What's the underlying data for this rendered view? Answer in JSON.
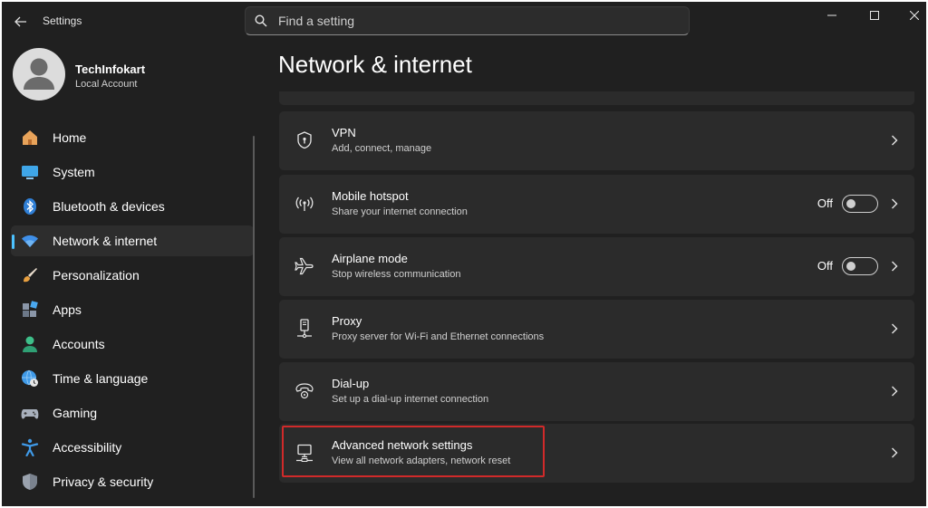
{
  "app": {
    "title": "Settings"
  },
  "search": {
    "placeholder": "Find a setting"
  },
  "profile": {
    "name": "TechInfokart",
    "account_type": "Local Account"
  },
  "sidebar": {
    "items": [
      {
        "label": "Home",
        "icon": "home-icon"
      },
      {
        "label": "System",
        "icon": "system-icon"
      },
      {
        "label": "Bluetooth & devices",
        "icon": "bluetooth-icon"
      },
      {
        "label": "Network & internet",
        "icon": "wifi-icon",
        "active": true
      },
      {
        "label": "Personalization",
        "icon": "brush-icon"
      },
      {
        "label": "Apps",
        "icon": "apps-icon"
      },
      {
        "label": "Accounts",
        "icon": "accounts-icon"
      },
      {
        "label": "Time & language",
        "icon": "globe-clock-icon"
      },
      {
        "label": "Gaming",
        "icon": "gamepad-icon"
      },
      {
        "label": "Accessibility",
        "icon": "accessibility-icon"
      },
      {
        "label": "Privacy & security",
        "icon": "shield-icon"
      }
    ]
  },
  "main": {
    "title": "Network & internet",
    "cards": [
      {
        "title": "VPN",
        "subtitle": "Add, connect, manage",
        "icon": "vpn-shield-icon"
      },
      {
        "title": "Mobile hotspot",
        "subtitle": "Share your internet connection",
        "icon": "hotspot-icon",
        "toggle": {
          "state_label": "Off",
          "on": false
        }
      },
      {
        "title": "Airplane mode",
        "subtitle": "Stop wireless communication",
        "icon": "airplane-icon",
        "toggle": {
          "state_label": "Off",
          "on": false
        }
      },
      {
        "title": "Proxy",
        "subtitle": "Proxy server for Wi-Fi and Ethernet connections",
        "icon": "proxy-icon"
      },
      {
        "title": "Dial-up",
        "subtitle": "Set up a dial-up internet connection",
        "icon": "dialup-icon"
      },
      {
        "title": "Advanced network settings",
        "subtitle": "View all network adapters, network reset",
        "icon": "network-adapter-icon",
        "highlighted": true
      }
    ]
  },
  "colors": {
    "background": "#202020",
    "card": "#2b2b2b",
    "accent": "#4cc2ff",
    "highlight": "#d12a2a"
  }
}
